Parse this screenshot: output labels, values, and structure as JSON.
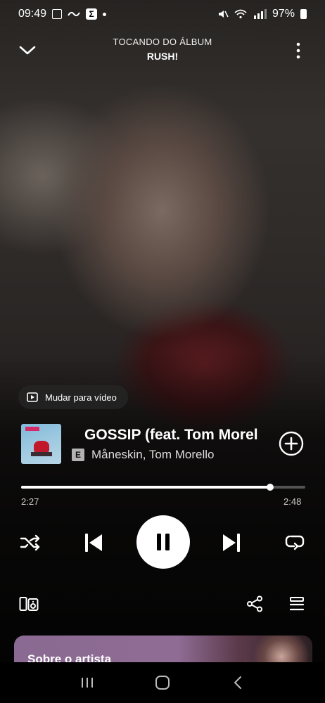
{
  "status_bar": {
    "time": "09:49",
    "battery": "97%"
  },
  "header": {
    "subtitle": "TOCANDO DO ÁLBUM",
    "title": "RUSH!"
  },
  "video_switch": {
    "label": "Mudar para vídeo"
  },
  "track": {
    "title": "GOSSIP (feat. Tom Morello)",
    "explicit_badge": "E",
    "artists": "Måneskin, Tom Morello"
  },
  "progress": {
    "elapsed": "2:27",
    "total": "2:48",
    "fraction": 0.875
  },
  "about_artist": {
    "label": "Sobre o artista"
  },
  "icons": {
    "collapse": "chevron-down-icon",
    "menu": "more-vertical-icon",
    "add": "add-circle-icon",
    "shuffle": "shuffle-icon",
    "previous": "skip-previous-icon",
    "pause": "pause-icon",
    "next": "skip-next-icon",
    "repeat": "repeat-icon",
    "devices": "devices-icon",
    "share": "share-icon",
    "queue": "queue-icon"
  }
}
